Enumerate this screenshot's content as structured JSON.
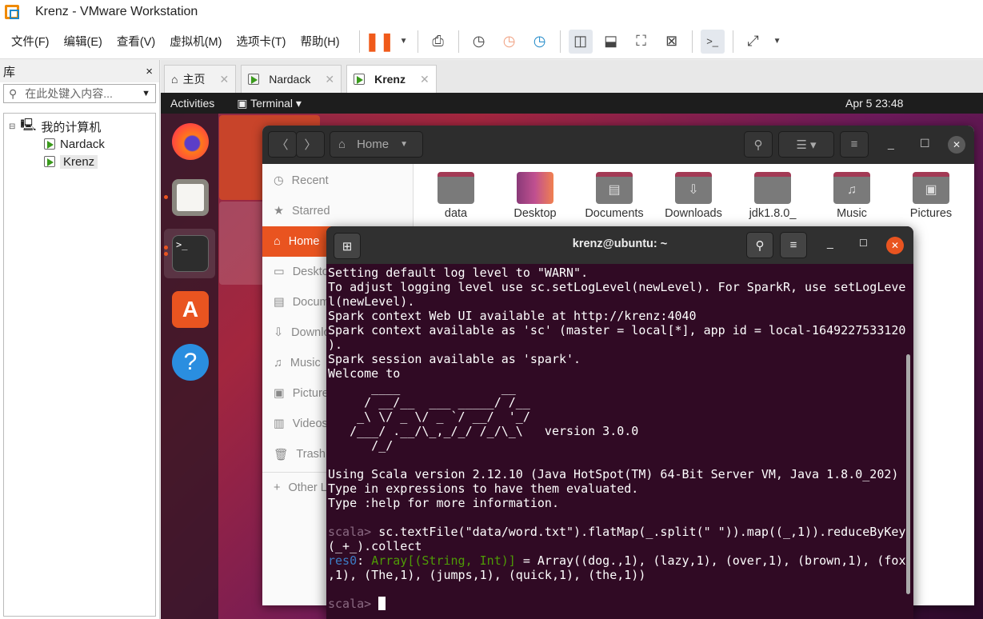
{
  "window": {
    "title": "Krenz - VMware Workstation"
  },
  "menu": [
    "文件(F)",
    "编辑(E)",
    "查看(V)",
    "虚拟机(M)",
    "选项卡(T)",
    "帮助(H)"
  ],
  "library": {
    "title": "库",
    "close": "×",
    "search_placeholder": "在此处键入内容...",
    "tree": [
      {
        "label": "我的计算机"
      },
      {
        "label": "Nardack"
      },
      {
        "label": "Krenz"
      }
    ]
  },
  "tabs": [
    {
      "label": "主页"
    },
    {
      "label": "Nardack"
    },
    {
      "label": "Krenz",
      "active": true
    }
  ],
  "ubuntu": {
    "activities": "Activities",
    "app_menu": "Terminal",
    "clock": "Apr 5  23:48"
  },
  "files": {
    "location": "Home",
    "sidebar": [
      "Recent",
      "Starred",
      "Home",
      "Desktop",
      "Documents",
      "Downloads",
      "Music",
      "Pictures",
      "Videos",
      "Trash",
      "Other Locations"
    ],
    "folders": [
      {
        "name": "data",
        "icon": "folder"
      },
      {
        "name": "Desktop",
        "icon": "desktop"
      },
      {
        "name": "Documents",
        "icon": "document"
      },
      {
        "name": "Downloads",
        "icon": "download"
      },
      {
        "name": "jdk1.8.0_",
        "icon": "folder"
      },
      {
        "name": "Music",
        "icon": "music"
      },
      {
        "name": "Pictures",
        "icon": "picture"
      }
    ]
  },
  "terminal": {
    "title": "krenz@ubuntu: ~",
    "output": "Setting default log level to \"WARN\".\nTo adjust logging level use sc.setLogLevel(newLevel). For SparkR, use setLogLeve\nl(newLevel).\nSpark context Web UI available at http://krenz:4040\nSpark context available as 'sc' (master = local[*], app id = local-1649227533120\n).\nSpark session available as 'spark'.\nWelcome to\n      ____              __\n     / __/__  ___ _____/ /__\n    _\\ \\/ _ \\/ _ `/ __/  '_/\n   /___/ .__/\\_,_/_/ /_/\\_\\   version 3.0.0\n      /_/\n\nUsing Scala version 2.12.10 (Java HotSpot(TM) 64-Bit Server VM, Java 1.8.0_202)\nType in expressions to have them evaluated.\nType :help for more information.\n",
    "prompt": "scala>",
    "command": " sc.textFile(\"data/word.txt\").flatMap(_.split(\" \")).map((_,1)).reduceByKey\n(_+_).collect",
    "res_name": "res0",
    "res_type": "Array[(String, Int)]",
    "res_value": " = Array((dog.,1), (lazy,1), (over,1), (brown,1), (fox\n,1), (The,1), (jumps,1), (quick,1), (the,1))"
  }
}
